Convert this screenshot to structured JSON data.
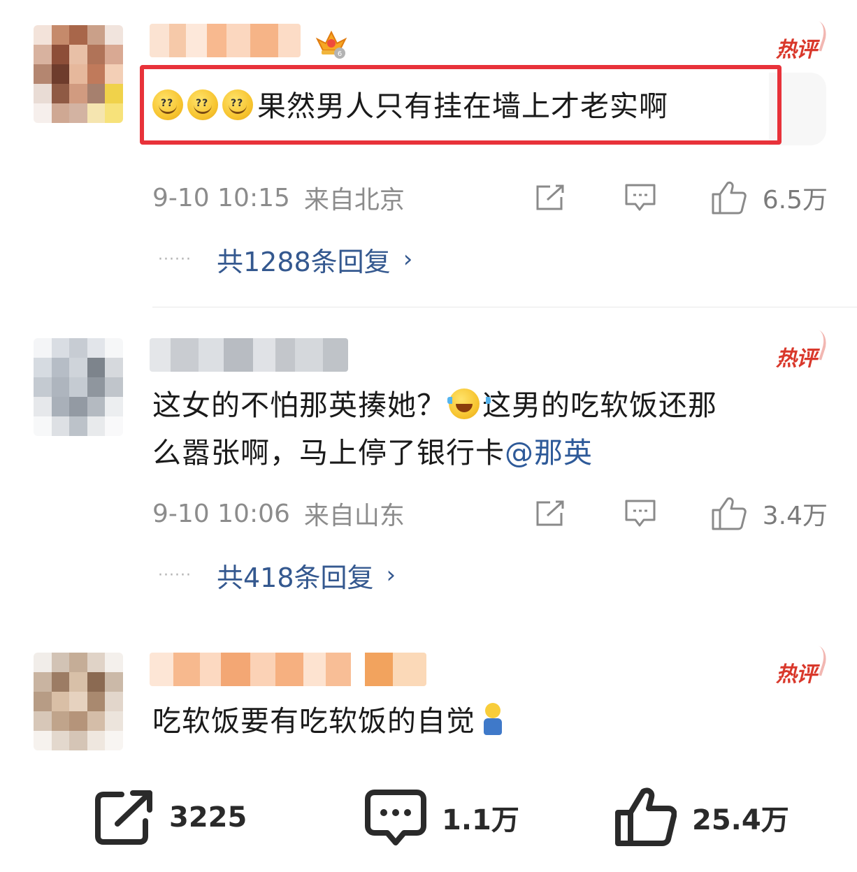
{
  "comments": [
    {
      "hot_label": "热评",
      "text": "果然男人只有挂在墙上才老实啊",
      "time": "9-10 10:15",
      "location": "来自北京",
      "likes": "6.5万",
      "replies": "共1288条回复",
      "replies_dots": "······"
    },
    {
      "hot_label": "热评",
      "text_line1": "这女的不怕那英揍她？",
      "text_line1b": "这男的吃软饭还那",
      "text_line2": "么嚣张啊，马上停了银行卡",
      "mention": "@那英",
      "time": "9-10 10:06",
      "location": "来自山东",
      "likes": "3.4万",
      "replies": "共418条回复",
      "replies_dots": "······"
    },
    {
      "hot_label": "热评",
      "text": "吃软饭要有吃软饭的自觉"
    }
  ],
  "footer": {
    "shares": "3225",
    "comments": "1.1万",
    "likes": "25.4万"
  },
  "colors": {
    "accent_red": "#e8323a",
    "hot_red": "#d9382b",
    "link_blue": "#34588f",
    "meta_gray": "#8c8c8c"
  },
  "icons": [
    "crown-badge-icon",
    "edit-icon",
    "comment-icon",
    "like-icon",
    "share-icon",
    "chevron-right-icon"
  ],
  "replies_chevron": "›"
}
